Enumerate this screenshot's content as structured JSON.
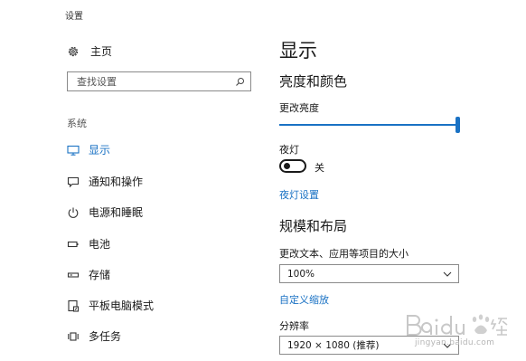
{
  "window": {
    "title": "设置"
  },
  "sidebar": {
    "home_label": "主页",
    "search": {
      "placeholder": "查找设置",
      "value": ""
    },
    "section_label": "系统",
    "items": [
      {
        "id": "display",
        "label": "显示",
        "icon": "monitor-icon",
        "active": true
      },
      {
        "id": "notifications",
        "label": "通知和操作",
        "icon": "notification-icon",
        "active": false
      },
      {
        "id": "power",
        "label": "电源和睡眠",
        "icon": "power-icon",
        "active": false
      },
      {
        "id": "battery",
        "label": "电池",
        "icon": "battery-icon",
        "active": false
      },
      {
        "id": "storage",
        "label": "存储",
        "icon": "storage-icon",
        "active": false
      },
      {
        "id": "tablet",
        "label": "平板电脑模式",
        "icon": "tablet-icon",
        "active": false
      },
      {
        "id": "multitasking",
        "label": "多任务",
        "icon": "multitasking-icon",
        "active": false
      }
    ]
  },
  "main": {
    "title": "显示",
    "brightness_color": {
      "heading": "亮度和颜色",
      "brightness_label": "更改亮度",
      "brightness_level": 1.0,
      "night_light_label": "夜灯",
      "night_light_state": "关",
      "night_light_settings_link": "夜灯设置"
    },
    "scale_layout": {
      "heading": "规模和布局",
      "scale_label": "更改文本、应用等项目的大小",
      "scale_value": "100%",
      "custom_scaling_link": "自定义缩放",
      "resolution_label": "分辨率",
      "resolution_value": "1920 × 1080 (推荐)"
    }
  },
  "watermark": {
    "text": "Baidu经验",
    "url": "jingyan.baidu.com"
  },
  "colors": {
    "accent": "#1a72c4",
    "text": "#1a1a1a",
    "border": "#8a8a8a"
  }
}
